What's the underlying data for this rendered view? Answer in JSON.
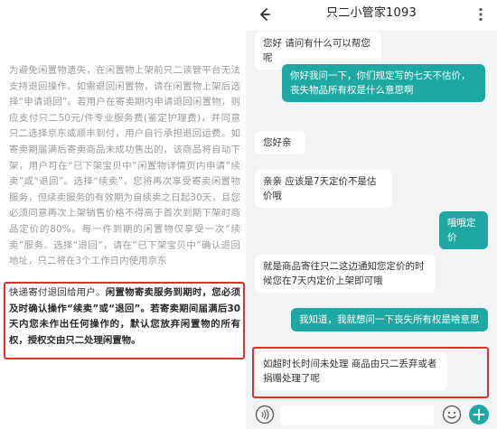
{
  "document": {
    "paragraph": "为避免闲置物遗失，在闲置物上架前只二读管平台无法支持退回操作。如需退回闲置物，请在闲置物上架后选择“申请退回”。若用户在寄卖期内申请退回闲置物，则应支付只二50元/件专业服务费(鉴定护理费)，并同意只二选择京东或顺丰到付，用户自行承担退回运费。如寄卖期届满后寄卖商品未成功售出的，该商品将自动下架，用户可在“已下架宝贝中”闲置物详情页内申请“续卖”或“退回”。选择“续卖”，您将再次享受寄卖闲置物服务，但续卖服务的有效期为自续卖之日起30天，且您必须同意再次上架销售价格不得高于首次到期下架时商品定价的80%。每一件到期的闲置物仅享受一次“续卖”服务。选择“退回”，请在“已下架宝贝中”确认退回地址，只二将在3个工作日内使用京东",
    "highlight_plain": "快递寄付退回给用户。",
    "highlight_bold": "闲置物寄卖服务到期时，您必须及时确认操作“续卖”或“退回”。若寄卖期间届满后30天内您未作出任何操作的，默认您放弃闲置物的所有权，授权交由只二处理闲置物。"
  },
  "chat": {
    "title": "只二小管家1093",
    "messages": [
      {
        "role": "agent",
        "text": "您好 请问有什么可以帮您呢"
      },
      {
        "role": "user",
        "text": "你好我问一下，你们规定写的七天不估价，丧失物品所有权是什么意思啊"
      },
      {
        "role": "agent",
        "text": "您好亲"
      },
      {
        "role": "agent",
        "text": "亲亲 应该是7天定价不是估价哦"
      },
      {
        "role": "user",
        "text": "哦哦定价"
      },
      {
        "role": "agent",
        "text": "就是商品寄往只二这边通知您定价的时候您在7天内定价上架即可哦"
      },
      {
        "role": "user",
        "text": "我知道，我就想问一下丧失所有权是啥意思"
      },
      {
        "role": "agent",
        "text": "如超时长时间未处理 商品由只二丢弃或者捐赠处理了呢"
      }
    ],
    "input_value": ""
  },
  "icons": {
    "back": "arrow-left-icon",
    "more": "more-vertical-icon",
    "voice": "voice-icon",
    "emoji": "emoji-icon",
    "plus": "plus-icon"
  },
  "colors": {
    "accent": "#1fa8a3",
    "highlight_border": "#e2302b",
    "chat_bg": "#f3f4f6"
  }
}
